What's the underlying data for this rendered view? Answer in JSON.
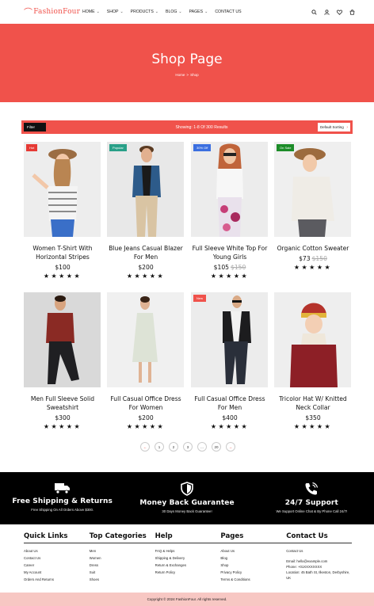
{
  "header": {
    "logo": "FashionFour",
    "nav": [
      {
        "label": "HOME",
        "dropdown": true
      },
      {
        "label": "SHOP",
        "dropdown": true
      },
      {
        "label": "PRODUCTS",
        "dropdown": true
      },
      {
        "label": "BLOG",
        "dropdown": true
      },
      {
        "label": "PAGES",
        "dropdown": true
      },
      {
        "label": "CONTACT US",
        "dropdown": false
      }
    ],
    "icons": [
      "search-icon",
      "user-icon",
      "heart-icon",
      "cart-icon"
    ]
  },
  "hero": {
    "title": "Shop Page",
    "breadcrumb": {
      "home": "Home",
      "sep": ">",
      "current": "Shop"
    }
  },
  "toolbar": {
    "filter_label": "Filter",
    "showing": "Showing: 1-8 Of 300 Results",
    "sort_label": "Default Sorting"
  },
  "products": [
    {
      "name": "Women T-Shirt With Horizontal Stripes",
      "price": "$100",
      "old_price": "",
      "badge": "Hot",
      "badge_color": "#e63a35"
    },
    {
      "name": "Blue Jeans Casual Blazer For Men",
      "price": "$200",
      "old_price": "",
      "badge": "Popular",
      "badge_color": "#29a088"
    },
    {
      "name": "Full Sleeve White Top For Young Girls",
      "price": "$105",
      "old_price": "$150",
      "badge": "30% Off",
      "badge_color": "#3b6fe0"
    },
    {
      "name": "Organic Cotton Sweater",
      "price": "$73",
      "old_price": "$150",
      "badge": "On Sale",
      "badge_color": "#1c8c28"
    },
    {
      "name": "Men Full Sleeve Solid Sweatshirt",
      "price": "$300",
      "old_price": "",
      "badge": "",
      "badge_color": ""
    },
    {
      "name": "Full Casual Office Dress For Women",
      "price": "$200",
      "old_price": "",
      "badge": "",
      "badge_color": ""
    },
    {
      "name": "Full Casual Office Dress For Men",
      "price": "$400",
      "old_price": "",
      "badge": "New",
      "badge_color": "#f0524b"
    },
    {
      "name": "Tricolor Hat W/ Knitted Neck Collar",
      "price": "$350",
      "old_price": "",
      "badge": "",
      "badge_color": ""
    }
  ],
  "stars": "★★★★★",
  "pagination": [
    "←",
    "1",
    "2",
    "3",
    "...",
    "20",
    "→"
  ],
  "features": [
    {
      "icon": "truck-icon",
      "title": "Free Shipping & Returns",
      "sub": "Free Shipping On All Orders Above $300."
    },
    {
      "icon": "shield-icon",
      "title": "Money Back Guarantee",
      "sub": "30 Days Money Back Guarantee!"
    },
    {
      "icon": "phone-icon",
      "title": "24/7 Support",
      "sub": "We Support Online Chat & By Phone Call 24/7!"
    }
  ],
  "footer": {
    "quick_links": {
      "title": "Quick Links",
      "items": [
        "About Us",
        "Contact Us",
        "Career",
        "My Account",
        "Orders And Returns"
      ]
    },
    "top_categories": {
      "title": "Top Categories",
      "items": [
        "Men",
        "Women",
        "Dress",
        "Suit",
        "Shoes"
      ]
    },
    "help": {
      "title": "Help",
      "items": [
        "FAQ & Helps",
        "Shipping & Delivery",
        "Return & Exchanges",
        "Return Policy"
      ]
    },
    "pages": {
      "title": "Pages",
      "items": [
        "About Us",
        "Blog",
        "Shop",
        "Privacy Policy",
        "Terms & Conditions"
      ]
    },
    "contact": {
      "title": "Contact Us",
      "link": "Contact Us",
      "email": "Email: hello@example.com",
      "phone": "Phone: +01XXXXXXXX",
      "location": "Location: 45 Bath St, Ilkeston, Derbyshire, UK"
    }
  },
  "copyright": "Copyright © 2024 FashionFour. All rights reserved."
}
